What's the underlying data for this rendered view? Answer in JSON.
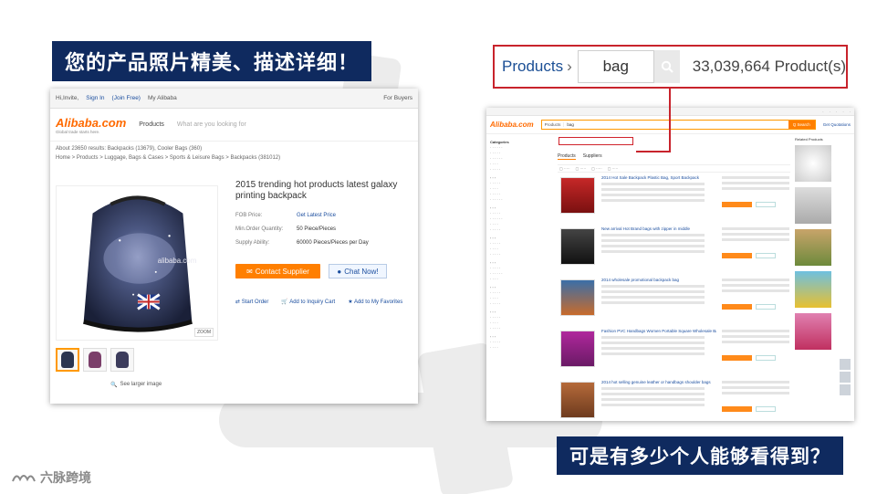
{
  "left_title": "您的产品照片精美、描述详细！",
  "bottom_title": "可是有多少个人能够看得到？",
  "brand": {
    "name": "六脉跨境"
  },
  "callout": {
    "category": "Products",
    "chevron": "›",
    "search_value": "bag",
    "search_icon": "search-icon",
    "result_count": "33,039,664 Product(s)"
  },
  "left_page": {
    "topbar": {
      "greeting": "Hi,Invite,",
      "sign_in": "Sign In",
      "join": "(Join Free)",
      "my_alibaba": "My Alibaba",
      "for_buyers": "For Buyers"
    },
    "logo": {
      "name": "Alibaba.com",
      "tagline": "Global trade starts here."
    },
    "products_dd": "Products",
    "search_placeholder": "What are you looking for",
    "crumbs_1": "About 23650 results: Backpacks (13679), Cooler Bags (360)",
    "crumbs_2": "Home > Products > Luggage, Bags & Cases > Sports & Leisure Bags > Backpacks (381012)",
    "product_title": "2015 trending hot products latest galaxy printing backpack",
    "specs": [
      {
        "label": "FOB Price:",
        "value": "Get Latest Price"
      },
      {
        "label": "Min.Order Quantity:",
        "value": "50 Piece/Pieces"
      },
      {
        "label": "Supply Ability:",
        "value": "60000 Pieces/Pieces per Day"
      }
    ],
    "contact_button": "Contact Supplier",
    "chat_button": "Chat Now!",
    "actions": [
      "Start Order",
      "Add to Inquiry Cart",
      "Add to My Favorites"
    ],
    "zoom": "ZOOM",
    "see_larger": "See larger image",
    "watermark": "alibaba.com"
  },
  "right_page": {
    "products_dd": "Products",
    "query": "bag",
    "go": "Q Search",
    "quote": "Get Quotations",
    "categories": "Categories",
    "tabs": [
      "Products",
      "Suppliers"
    ],
    "results": [
      "2014 Hot Sale Backpack Plastic Bag, Sport Backpack",
      "New arrival Hot Brand bags with zipper in middle",
      "2014 wholesale promotional backpack bag",
      "Fashion PVC Handbags Women Portable Square Wholesale Bag",
      "2014 hot selling genuine leather or handbags shoulder bags"
    ],
    "related": "Related Products"
  }
}
